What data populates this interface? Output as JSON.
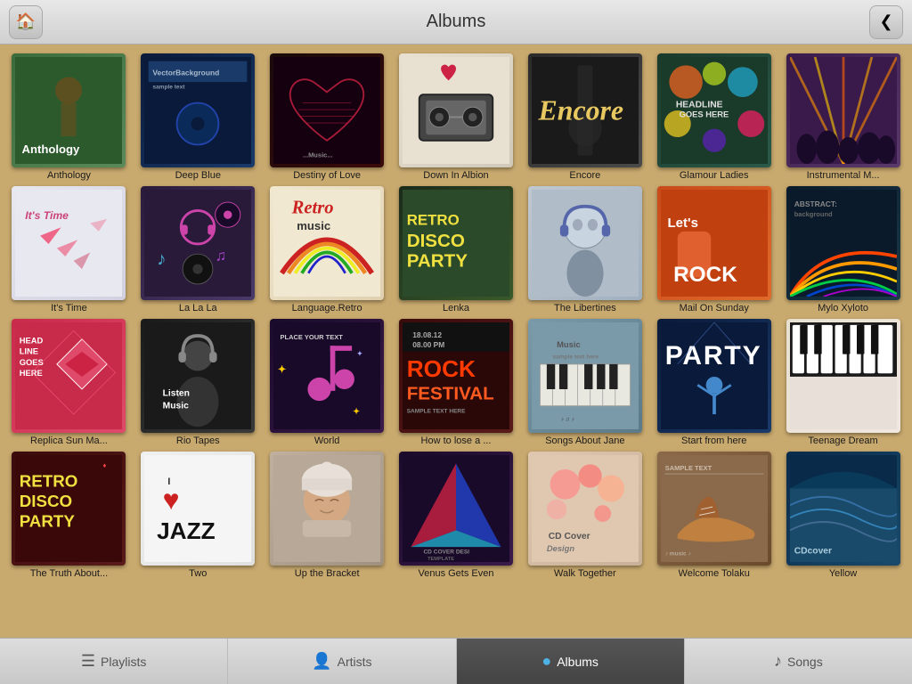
{
  "header": {
    "title": "Albums",
    "home_button": "🏠",
    "back_button": "❮"
  },
  "albums": [
    {
      "id": "anthology",
      "title": "Anthology",
      "cover_class": "cover-anthology",
      "row": 1
    },
    {
      "id": "deep-blue",
      "title": "Deep Blue",
      "cover_class": "cover-deep-blue",
      "row": 1
    },
    {
      "id": "destiny",
      "title": "Destiny of Love",
      "cover_class": "cover-destiny",
      "row": 1
    },
    {
      "id": "down-albion",
      "title": "Down In Albion",
      "cover_class": "cover-down-albion",
      "row": 1
    },
    {
      "id": "encore",
      "title": "Encore",
      "cover_class": "cover-encore",
      "row": 1
    },
    {
      "id": "glamour",
      "title": "Glamour Ladies",
      "cover_class": "cover-glamour",
      "row": 1
    },
    {
      "id": "instrumental",
      "title": "Instrumental M...",
      "cover_class": "cover-instrumental",
      "row": 1
    },
    {
      "id": "its-time",
      "title": "It's Time",
      "cover_class": "cover-its-time",
      "row": 2
    },
    {
      "id": "lalala",
      "title": "La La La",
      "cover_class": "cover-lalala",
      "row": 2
    },
    {
      "id": "language",
      "title": "Language.Retro",
      "cover_class": "cover-language",
      "row": 2
    },
    {
      "id": "lenka",
      "title": "Lenka",
      "cover_class": "cover-lenka",
      "row": 2
    },
    {
      "id": "libertines",
      "title": "The Libertines",
      "cover_class": "cover-libertines",
      "row": 2
    },
    {
      "id": "mail",
      "title": "Mail On Sunday",
      "cover_class": "cover-mail",
      "row": 2
    },
    {
      "id": "mylo",
      "title": "Mylo Xyloto",
      "cover_class": "cover-mylo",
      "row": 2
    },
    {
      "id": "replica",
      "title": "Replica Sun Ma...",
      "cover_class": "cover-replica",
      "row": 3
    },
    {
      "id": "rio",
      "title": "Rio Tapes",
      "cover_class": "cover-rio",
      "row": 3
    },
    {
      "id": "world",
      "title": "World",
      "cover_class": "cover-world",
      "row": 3
    },
    {
      "id": "lose",
      "title": "How to lose a ...",
      "cover_class": "cover-lose",
      "row": 3
    },
    {
      "id": "songs",
      "title": "Songs About Jane",
      "cover_class": "cover-songs",
      "row": 3
    },
    {
      "id": "start",
      "title": "Start from here",
      "cover_class": "cover-start",
      "row": 3
    },
    {
      "id": "teenage",
      "title": "Teenage Dream",
      "cover_class": "cover-teenage",
      "row": 3
    },
    {
      "id": "truth",
      "title": "The Truth About...",
      "cover_class": "cover-truth",
      "row": 4
    },
    {
      "id": "two",
      "title": "Two",
      "cover_class": "cover-two",
      "row": 4
    },
    {
      "id": "bracket",
      "title": "Up the Bracket",
      "cover_class": "cover-bracket",
      "row": 4
    },
    {
      "id": "venus",
      "title": "Venus Gets Even",
      "cover_class": "cover-venus",
      "row": 4
    },
    {
      "id": "walk",
      "title": "Walk Together",
      "cover_class": "cover-walk",
      "row": 4
    },
    {
      "id": "welcome",
      "title": "Welcome Tolaku",
      "cover_class": "cover-welcome",
      "row": 4
    },
    {
      "id": "yellow",
      "title": "Yellow",
      "cover_class": "cover-yellow",
      "row": 4
    }
  ],
  "nav": {
    "items": [
      {
        "id": "playlists",
        "label": "Playlists",
        "icon": "☰",
        "active": false
      },
      {
        "id": "artists",
        "label": "Artists",
        "icon": "👤",
        "active": false
      },
      {
        "id": "albums",
        "label": "Albums",
        "icon": "●",
        "active": true
      },
      {
        "id": "songs",
        "label": "Songs",
        "icon": "♪",
        "active": false
      }
    ]
  }
}
